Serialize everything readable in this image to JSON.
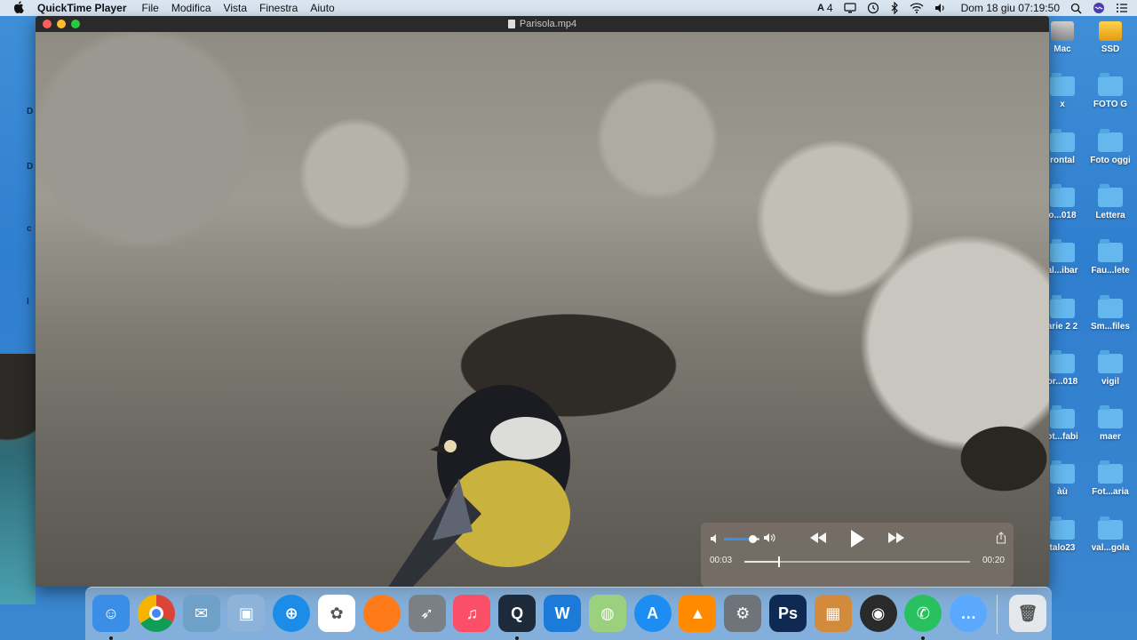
{
  "menubar": {
    "app_name": "QuickTime Player",
    "menus": [
      "File",
      "Modifica",
      "Vista",
      "Finestra",
      "Aiuto"
    ],
    "status": {
      "keyboard_count": "4",
      "datetime": "Dom 18 giu  07:19:50"
    }
  },
  "window": {
    "title": "Parisola.mp4"
  },
  "player": {
    "elapsed": "00:03",
    "total": "00:20",
    "progress": 0.15,
    "volume": 0.8
  },
  "desktop_left_fragments": [
    "D",
    "D",
    "c",
    "I"
  ],
  "desktop_icons": [
    {
      "label": "Mac",
      "icon": "hard-drive-icon"
    },
    {
      "label": "SSD",
      "icon": "ssd-drive-icon"
    },
    {
      "label": "x",
      "icon": "folder-icon"
    },
    {
      "label": "FOTO G",
      "icon": "folder-icon"
    },
    {
      "label": "rontal",
      "icon": "folder-icon"
    },
    {
      "label": "Foto oggi",
      "icon": "folder-icon"
    },
    {
      "label": "o...018",
      "icon": "folder-icon"
    },
    {
      "label": "Lettera",
      "icon": "folder-icon"
    },
    {
      "label": "al...ibar",
      "icon": "folder-icon"
    },
    {
      "label": "Fau...lete",
      "icon": "folder-icon"
    },
    {
      "label": "arie 2 2",
      "icon": "folder-icon"
    },
    {
      "label": "Sm...files",
      "icon": "folder-icon"
    },
    {
      "label": "or...018",
      "icon": "folder-icon"
    },
    {
      "label": "vigil",
      "icon": "folder-icon"
    },
    {
      "label": "ot...fabi",
      "icon": "folder-icon"
    },
    {
      "label": "maer",
      "icon": "folder-icon"
    },
    {
      "label": "àù",
      "icon": "folder-icon"
    },
    {
      "label": "Fot...aria",
      "icon": "folder-icon"
    },
    {
      "label": "talo23",
      "icon": "folder-icon"
    },
    {
      "label": "val...gola",
      "icon": "folder-icon"
    }
  ],
  "dock": [
    {
      "name": "finder-icon",
      "color": "#3a8ee6",
      "glyph": "☺",
      "running": true
    },
    {
      "name": "chrome-icon",
      "color": "#ffffff",
      "glyph": "",
      "running": false
    },
    {
      "name": "preview-icon",
      "color": "#6fa0c8",
      "glyph": "✉",
      "running": false
    },
    {
      "name": "photo-browser-icon",
      "color": "#8db4d8",
      "glyph": "▣",
      "running": false
    },
    {
      "name": "safari-icon",
      "color": "#1b8de8",
      "glyph": "⊕",
      "running": false
    },
    {
      "name": "photos-icon",
      "color": "#ffffff",
      "glyph": "✿",
      "running": false
    },
    {
      "name": "firefox-icon",
      "color": "#ff7a18",
      "glyph": "",
      "running": false
    },
    {
      "name": "launchpad-icon",
      "color": "#7b7f86",
      "glyph": "➶",
      "running": false
    },
    {
      "name": "music-icon",
      "color": "#fb4f67",
      "glyph": "♫",
      "running": false
    },
    {
      "name": "quicktime-icon",
      "color": "#1c2a3a",
      "glyph": "Q",
      "running": true
    },
    {
      "name": "word-icon",
      "color": "#1c7bd8",
      "glyph": "W",
      "running": false
    },
    {
      "name": "maps-icon",
      "color": "#9bd07f",
      "glyph": "◍",
      "running": false
    },
    {
      "name": "app-store-icon",
      "color": "#1d8df3",
      "glyph": "A",
      "running": false
    },
    {
      "name": "vlc-icon",
      "color": "#ff8a00",
      "glyph": "▲",
      "running": false
    },
    {
      "name": "system-preferences-icon",
      "color": "#6f747b",
      "glyph": "⚙",
      "running": false
    },
    {
      "name": "photoshop-icon",
      "color": "#0f2a52",
      "glyph": "Ps",
      "running": false
    },
    {
      "name": "calculator-icon",
      "color": "#d28a3d",
      "glyph": "▦",
      "running": false
    },
    {
      "name": "photo-booth-icon",
      "color": "#2a2a2a",
      "glyph": "◉",
      "running": false
    },
    {
      "name": "whatsapp-icon",
      "color": "#29c160",
      "glyph": "✆",
      "running": true
    },
    {
      "name": "messages-icon",
      "color": "#5aa9ff",
      "glyph": "…",
      "running": false
    },
    {
      "name": "trash-icon",
      "color": "#e4e8ec",
      "glyph": "🗑",
      "running": false
    }
  ]
}
